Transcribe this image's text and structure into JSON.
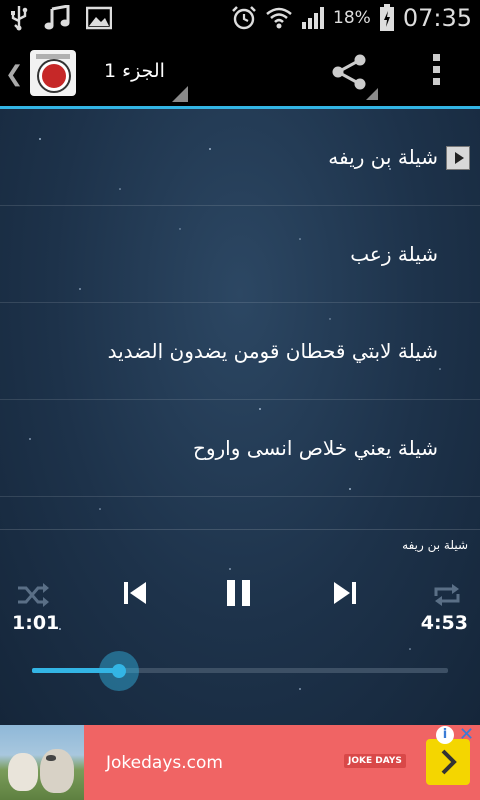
{
  "status_bar": {
    "icons": [
      "usb-icon",
      "music-note-icon",
      "image-icon",
      "alarm-icon",
      "wifi-icon",
      "signal-icon",
      "battery-icon"
    ],
    "battery": "18%",
    "time": "07:35"
  },
  "action_bar": {
    "spinner_title": "الجزء 1"
  },
  "tracks": [
    {
      "title": "شيلة بن ريفه",
      "playing": true
    },
    {
      "title": "شيلة زعب",
      "playing": false
    },
    {
      "title": "شيلة لابتي قحطان قومن يضدون الضديد",
      "playing": false
    },
    {
      "title": "شيلة يعني خلاص انسى واروح",
      "playing": false
    }
  ],
  "player": {
    "now_playing": "شيلة بن ريفه",
    "elapsed": "1:01",
    "duration": "4:53",
    "progress": 0.21
  },
  "ad": {
    "text": "Jokedays.com",
    "logo": "JOKE DAYS",
    "info": "i",
    "close": "✕"
  },
  "colors": {
    "accent": "#33b5e5",
    "ad_background": "#f06464",
    "ad_button": "#f4d600"
  }
}
